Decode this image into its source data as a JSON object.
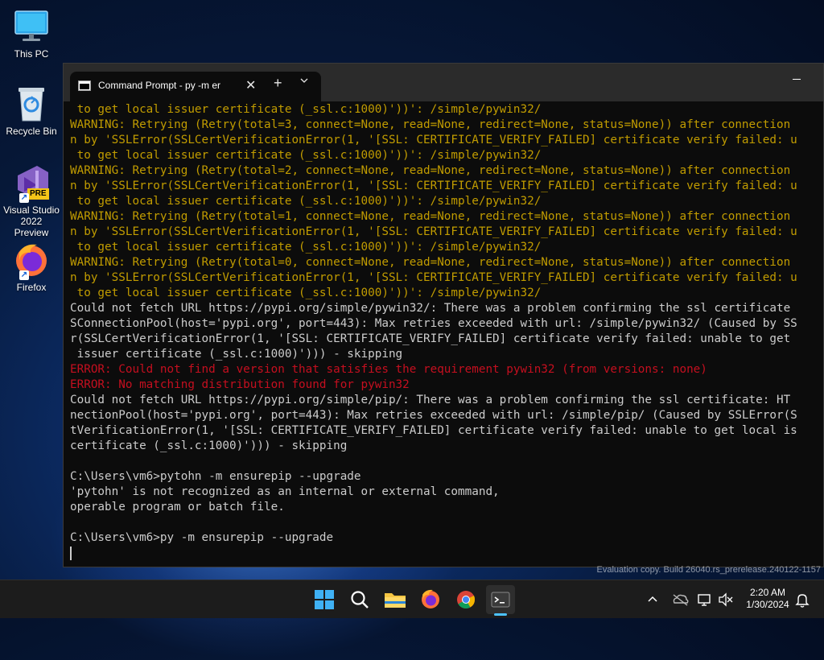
{
  "desktop": {
    "icons": [
      {
        "label": "This PC"
      },
      {
        "label": "Recycle Bin"
      },
      {
        "label": "Visual Studio 2022 Preview",
        "badge": "PRE"
      },
      {
        "label": "Firefox"
      }
    ]
  },
  "window": {
    "tab_title": "Command Prompt - py  -m er",
    "close_glyph": "✕",
    "new_tab_glyph": "+"
  },
  "console_lines": [
    {
      "text": " to get local issuer certificate (_ssl.c:1000)'))': /simple/pywin32/",
      "kind": "warn"
    },
    {
      "text": "WARNING: Retrying (Retry(total=3, connect=None, read=None, redirect=None, status=None)) after connection",
      "kind": "warn"
    },
    {
      "text": "n by 'SSLError(SSLCertVerificationError(1, '[SSL: CERTIFICATE_VERIFY_FAILED] certificate verify failed: u",
      "kind": "warn"
    },
    {
      "text": " to get local issuer certificate (_ssl.c:1000)'))': /simple/pywin32/",
      "kind": "warn"
    },
    {
      "text": "WARNING: Retrying (Retry(total=2, connect=None, read=None, redirect=None, status=None)) after connection",
      "kind": "warn"
    },
    {
      "text": "n by 'SSLError(SSLCertVerificationError(1, '[SSL: CERTIFICATE_VERIFY_FAILED] certificate verify failed: u",
      "kind": "warn"
    },
    {
      "text": " to get local issuer certificate (_ssl.c:1000)'))': /simple/pywin32/",
      "kind": "warn"
    },
    {
      "text": "WARNING: Retrying (Retry(total=1, connect=None, read=None, redirect=None, status=None)) after connection",
      "kind": "warn"
    },
    {
      "text": "n by 'SSLError(SSLCertVerificationError(1, '[SSL: CERTIFICATE_VERIFY_FAILED] certificate verify failed: u",
      "kind": "warn"
    },
    {
      "text": " to get local issuer certificate (_ssl.c:1000)'))': /simple/pywin32/",
      "kind": "warn"
    },
    {
      "text": "WARNING: Retrying (Retry(total=0, connect=None, read=None, redirect=None, status=None)) after connection",
      "kind": "warn"
    },
    {
      "text": "n by 'SSLError(SSLCertVerificationError(1, '[SSL: CERTIFICATE_VERIFY_FAILED] certificate verify failed: u",
      "kind": "warn"
    },
    {
      "text": " to get local issuer certificate (_ssl.c:1000)'))': /simple/pywin32/",
      "kind": "warn"
    },
    {
      "text": "Could not fetch URL https://pypi.org/simple/pywin32/: There was a problem confirming the ssl certificate",
      "kind": "norm"
    },
    {
      "text": "SConnectionPool(host='pypi.org', port=443): Max retries exceeded with url: /simple/pywin32/ (Caused by SS",
      "kind": "norm"
    },
    {
      "text": "r(SSLCertVerificationError(1, '[SSL: CERTIFICATE_VERIFY_FAILED] certificate verify failed: unable to get",
      "kind": "norm"
    },
    {
      "text": " issuer certificate (_ssl.c:1000)'))) - skipping",
      "kind": "norm"
    },
    {
      "text": "ERROR: Could not find a version that satisfies the requirement pywin32 (from versions: none)",
      "kind": "err"
    },
    {
      "text": "ERROR: No matching distribution found for pywin32",
      "kind": "err"
    },
    {
      "text": "Could not fetch URL https://pypi.org/simple/pip/: There was a problem confirming the ssl certificate: HT",
      "kind": "norm"
    },
    {
      "text": "nectionPool(host='pypi.org', port=443): Max retries exceeded with url: /simple/pip/ (Caused by SSLError(S",
      "kind": "norm"
    },
    {
      "text": "tVerificationError(1, '[SSL: CERTIFICATE_VERIFY_FAILED] certificate verify failed: unable to get local is",
      "kind": "norm"
    },
    {
      "text": "certificate (_ssl.c:1000)'))) - skipping",
      "kind": "norm"
    },
    {
      "text": "",
      "kind": "norm"
    },
    {
      "text": "C:\\Users\\vm6>pytohn -m ensurepip --upgrade",
      "kind": "norm"
    },
    {
      "text": "'pytohn' is not recognized as an internal or external command,",
      "kind": "norm"
    },
    {
      "text": "operable program or batch file.",
      "kind": "norm"
    },
    {
      "text": "",
      "kind": "norm"
    },
    {
      "text": "C:\\Users\\vm6>py -m ensurepip --upgrade",
      "kind": "norm"
    }
  ],
  "watermark": "Evaluation copy. Build 26040.rs_prerelease.240122-1157",
  "taskbar": {
    "time": "2:20 AM",
    "date": "1/30/2024"
  },
  "colors": {
    "warning": "#c19c00",
    "error": "#c50f1f",
    "normal": "#cccccc",
    "accent": "#4cc2ff"
  }
}
